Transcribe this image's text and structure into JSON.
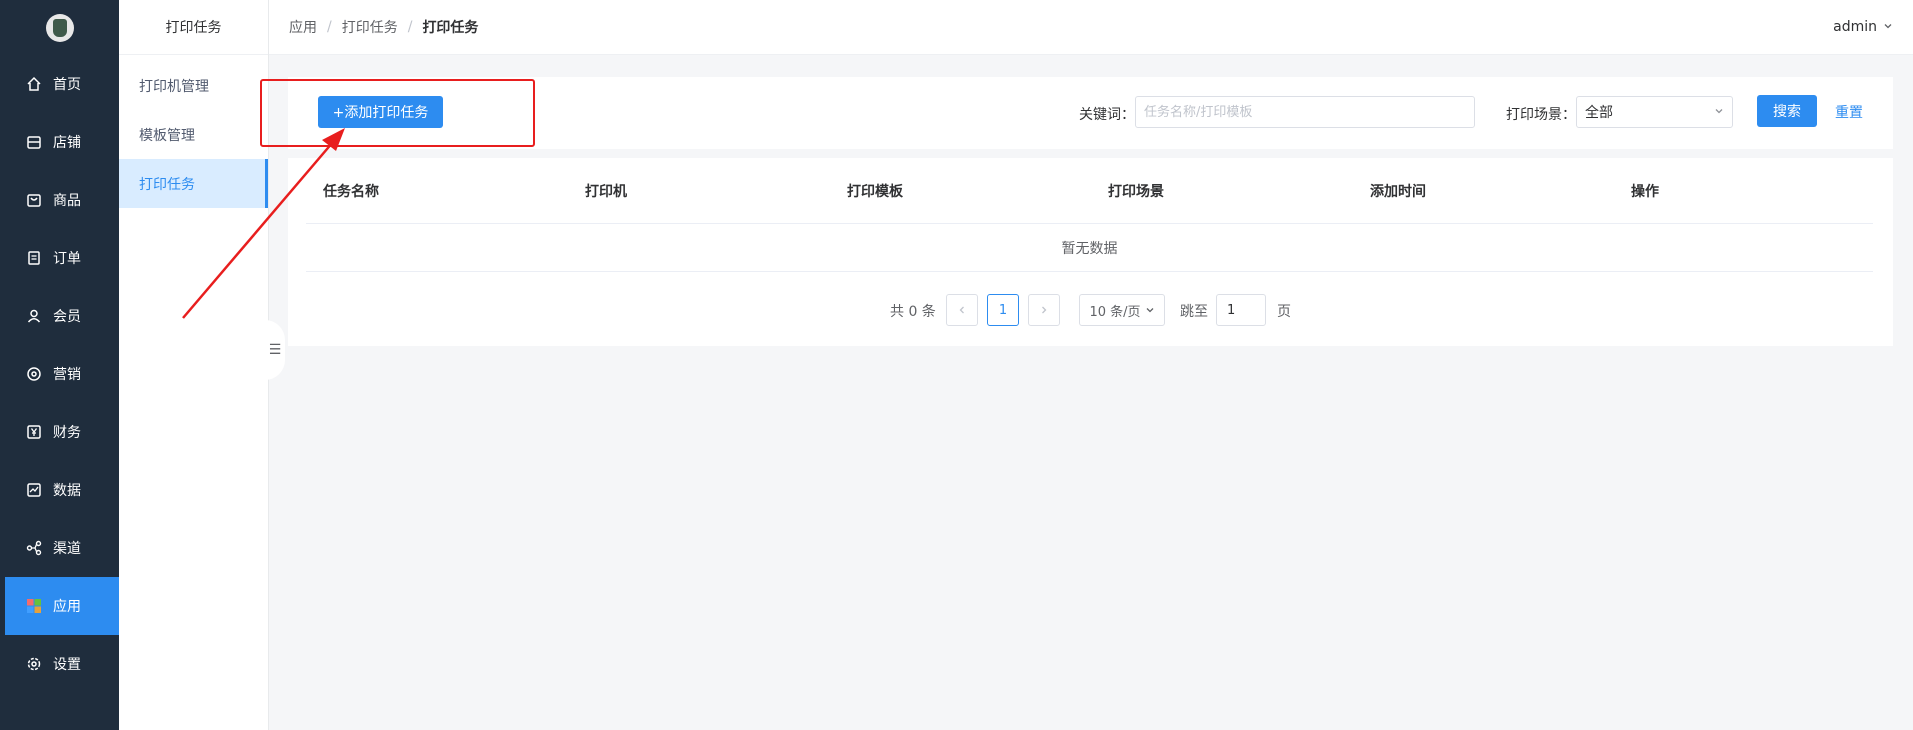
{
  "nav": {
    "items": [
      {
        "label": "首页",
        "icon": "home-icon"
      },
      {
        "label": "店铺",
        "icon": "store-icon"
      },
      {
        "label": "商品",
        "icon": "bag-icon"
      },
      {
        "label": "订单",
        "icon": "order-icon"
      },
      {
        "label": "会员",
        "icon": "user-icon"
      },
      {
        "label": "营销",
        "icon": "marketing-icon"
      },
      {
        "label": "财务",
        "icon": "yen-icon"
      },
      {
        "label": "数据",
        "icon": "chart-icon"
      },
      {
        "label": "渠道",
        "icon": "share-icon"
      },
      {
        "label": "应用",
        "icon": "apps-icon",
        "active": true
      },
      {
        "label": "设置",
        "icon": "gear-icon"
      }
    ]
  },
  "submenu": {
    "title": "打印任务",
    "items": [
      {
        "label": "打印机管理"
      },
      {
        "label": "模板管理"
      },
      {
        "label": "打印任务",
        "active": true
      }
    ]
  },
  "breadcrumb": [
    "应用",
    "打印任务",
    "打印任务"
  ],
  "user": {
    "name": "admin"
  },
  "filter": {
    "add_label": "+添加打印任务",
    "keyword_label": "关键词：",
    "keyword_placeholder": "任务名称/打印模板",
    "scene_label": "打印场景：",
    "scene_value": "全部",
    "search_label": "搜索",
    "reset_label": "重置"
  },
  "table": {
    "columns": [
      "任务名称",
      "打印机",
      "打印模板",
      "打印场景",
      "添加时间",
      "操作"
    ],
    "empty_text": "暂无数据"
  },
  "pagination": {
    "total_text": "共 0 条",
    "current_page": "1",
    "page_size": "10 条/页",
    "jump_label": "跳至",
    "jump_value": "1",
    "page_suffix": "页"
  },
  "colors": {
    "primary": "#2d8cf0",
    "nav_bg": "#1f2d3d",
    "annotation": "#e81e1e"
  }
}
